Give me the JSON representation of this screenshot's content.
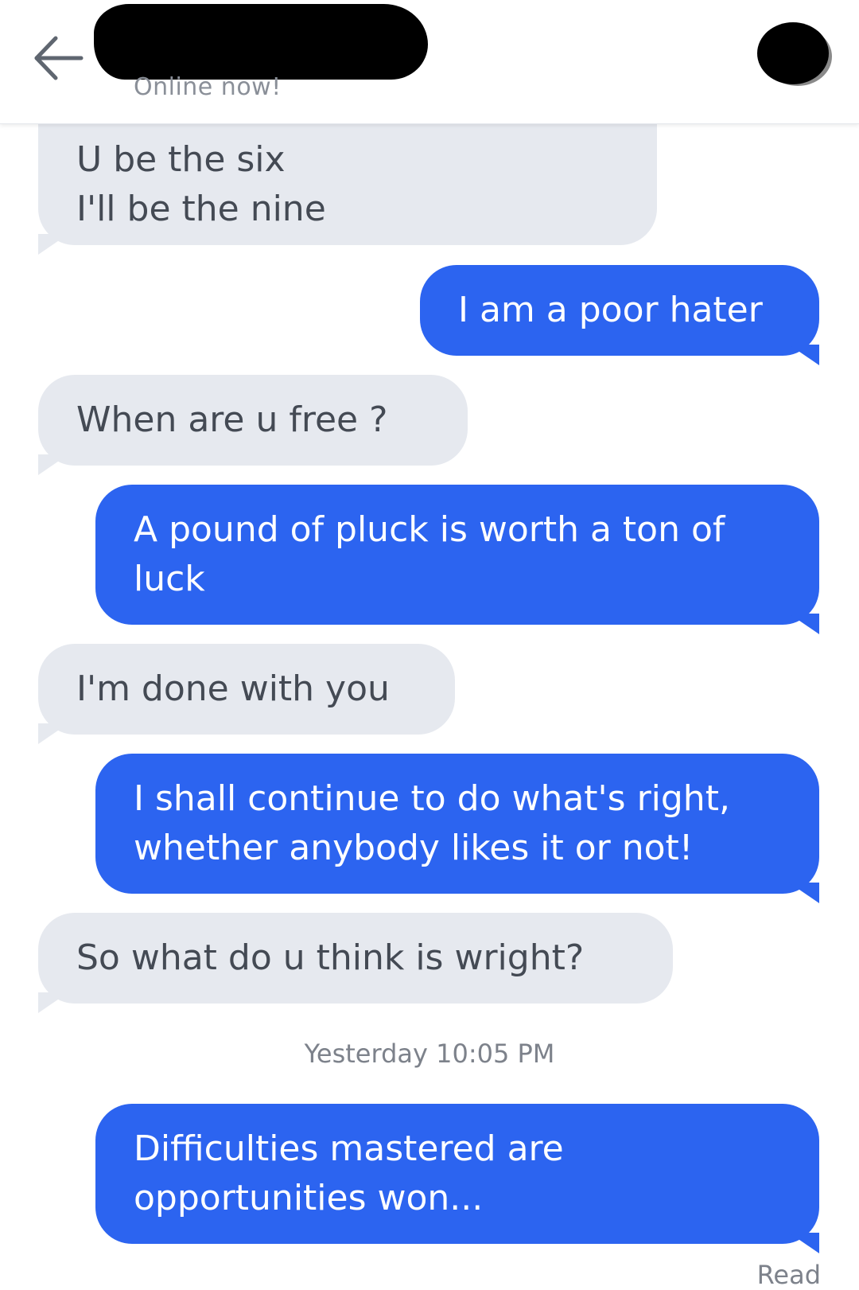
{
  "header": {
    "status": "Online now!",
    "back_icon": "arrow-left-icon"
  },
  "messages": [
    {
      "direction": "in",
      "text": "U be the six\nI'll be the nine"
    },
    {
      "direction": "out",
      "text": "I am a poor hater"
    },
    {
      "direction": "in",
      "text": "When are u free ?"
    },
    {
      "direction": "out",
      "text": "A pound of pluck is worth a ton of luck"
    },
    {
      "direction": "in",
      "text": "I'm done with you"
    },
    {
      "direction": "out",
      "text": "I shall continue to do what's right, whether anybody likes it or not!"
    },
    {
      "direction": "in",
      "text": "So what do u think is wright?"
    },
    {
      "direction": "out",
      "text": "Difficulties mastered are opportunities won..."
    }
  ],
  "timestamp": "Yesterday 10:05 PM",
  "read_receipt": "Read",
  "colors": {
    "outgoing_bubble": "#2c64f0",
    "incoming_bubble": "#e6e9ef",
    "incoming_text": "#444a54"
  }
}
